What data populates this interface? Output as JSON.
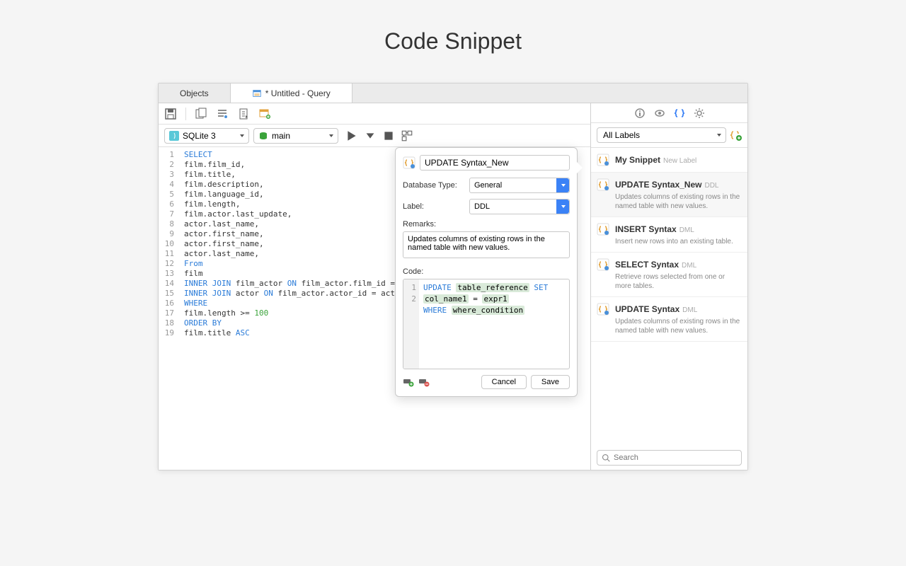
{
  "page_title": "Code Snippet",
  "tabs": {
    "objects": "Objects",
    "query": "* Untitled - Query"
  },
  "connection_combo": "SQLite 3",
  "database_combo": "main",
  "editor": {
    "lines": [
      {
        "n": 1,
        "html": "<span class='kw'>SELECT</span>"
      },
      {
        "n": 2,
        "html": "film.film_id,"
      },
      {
        "n": 3,
        "html": "film.title,"
      },
      {
        "n": 4,
        "html": "film.description,"
      },
      {
        "n": 5,
        "html": "film.language_id,"
      },
      {
        "n": 6,
        "html": "film.length,"
      },
      {
        "n": 7,
        "html": "film.actor.last_update,"
      },
      {
        "n": 8,
        "html": "actor.last_name,"
      },
      {
        "n": 9,
        "html": "actor.first_name,"
      },
      {
        "n": 10,
        "html": "actor.first_name,"
      },
      {
        "n": 11,
        "html": "actor.last_name,"
      },
      {
        "n": 12,
        "html": "<span class='kw'>From</span>"
      },
      {
        "n": 13,
        "html": "film"
      },
      {
        "n": 14,
        "html": "<span class='kw'>INNER JOIN</span> film_actor <span class='kw'>ON</span> film_actor.film_id = film.film_id"
      },
      {
        "n": 15,
        "html": "<span class='kw'>INNER JOIN</span> actor <span class='kw'>ON</span> film_actor.actor_id = actor.actor_id"
      },
      {
        "n": 16,
        "html": "<span class='kw'>WHERE</span>"
      },
      {
        "n": 17,
        "html": "film.length &gt;= <span class='num'>100</span>"
      },
      {
        "n": 18,
        "html": "<span class='kw'>ORDER BY</span>"
      },
      {
        "n": 19,
        "html": "film.title <span class='kw'>ASC</span>"
      }
    ]
  },
  "popover": {
    "name": "UPDATE Syntax_New",
    "db_type_label": "Database Type:",
    "db_type_value": "General",
    "label_label": "Label:",
    "label_value": "DDL",
    "remarks_label": "Remarks:",
    "remarks_value": "Updates columns of existing rows in the named table with new values.",
    "code_label": "Code:",
    "code_lines": [
      {
        "n": 1,
        "html": "<span class='tok-kw'>UPDATE</span> <span class='tok-var'>table_reference</span> <span class='tok-kw'>SET</span> <span class='tok-var'>col_name1</span> = <span class='tok-var'>expr1</span>"
      },
      {
        "n": 2,
        "html": "<span class='tok-kw'>WHERE</span> <span class='tok-var'>where_condition</span>"
      }
    ],
    "cancel": "Cancel",
    "save": "Save"
  },
  "sidebar": {
    "labels_filter": "All Labels",
    "search_placeholder": "Search",
    "snippets": [
      {
        "title": "My Snippet",
        "tag": "New Label",
        "desc": "",
        "selected": false
      },
      {
        "title": "UPDATE Syntax_New",
        "tag": "DDL",
        "desc": "Updates columns of existing rows in the named table with new values.",
        "selected": true
      },
      {
        "title": "INSERT Syntax",
        "tag": "DML",
        "desc": "Insert new rows into an existing table.",
        "selected": false
      },
      {
        "title": "SELECT Syntax",
        "tag": "DML",
        "desc": "Retrieve rows selected from one or more tables.",
        "selected": false
      },
      {
        "title": "UPDATE Syntax",
        "tag": "DML",
        "desc": "Updates columns of existing rows in the named table with new values.",
        "selected": false
      }
    ]
  }
}
